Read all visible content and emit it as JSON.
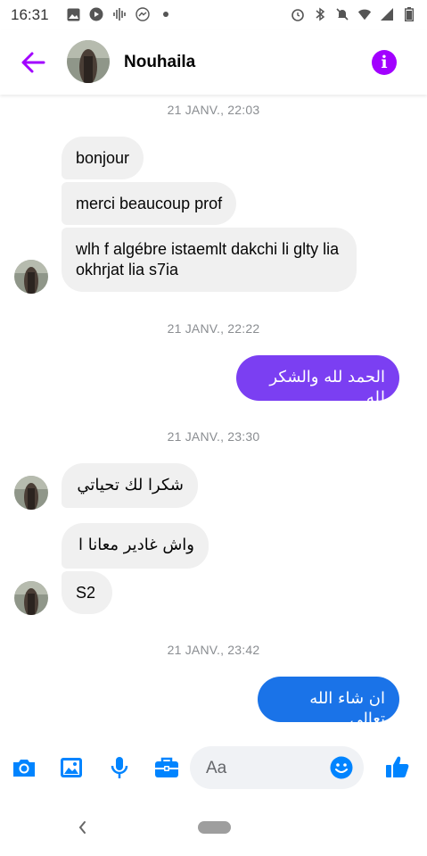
{
  "status_bar": {
    "time": "16:31",
    "left_icons": [
      "image-icon",
      "youtube-icon",
      "audio-wave-icon",
      "messenger-icon",
      "dot-icon"
    ],
    "right_icons": [
      "alarm-icon",
      "bluetooth-icon",
      "mute-icon",
      "wifi-icon",
      "signal-icon",
      "battery-icon"
    ]
  },
  "header": {
    "contact_name": "Nouhaila",
    "accent_color": "#a200ff"
  },
  "timestamps": [
    "21 JANV., 22:03",
    "21 JANV., 22:22",
    "21 JANV., 23:30",
    "21 JANV., 23:42"
  ],
  "messages": [
    {
      "from": "contact",
      "text": "bonjour"
    },
    {
      "from": "contact",
      "text": "merci beaucoup prof"
    },
    {
      "from": "contact",
      "text": "wlh f algébre istaemlt dakchi li glty lia okhrjat lia s7ia"
    },
    {
      "from": "me",
      "text": "الحمد لله والشكر لله",
      "color": "#7b3ff2"
    },
    {
      "from": "contact",
      "text": "شكرا لك تحياتي"
    },
    {
      "from": "contact",
      "text": "واش غادير معانا ا"
    },
    {
      "from": "contact",
      "text": "S2"
    },
    {
      "from": "me",
      "text": "ان شاء الله تعالى",
      "color": "#1a73e8"
    }
  ],
  "composer": {
    "placeholder": "Aa",
    "icons": [
      "camera-icon",
      "gallery-icon",
      "microphone-icon",
      "toolbox-icon",
      "emoji-icon",
      "thumbs-up-icon"
    ],
    "icon_color": "#0084ff"
  }
}
